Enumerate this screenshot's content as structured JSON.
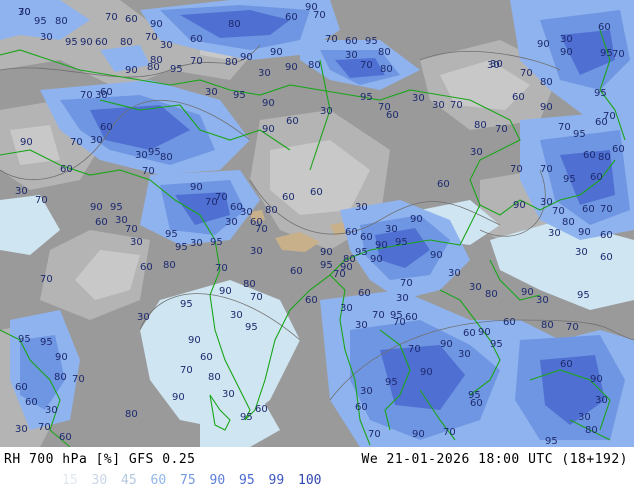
{
  "footer": {
    "title": "RH 700 hPa [%] GFS 0.25",
    "datetime": "We 21-01-2026 18:00 UTC (18+192)"
  },
  "legend": [
    {
      "label": "15",
      "color": "#dfe8f0"
    },
    {
      "label": "30",
      "color": "#c8d6e6"
    },
    {
      "label": "45",
      "color": "#b3c8e0"
    },
    {
      "label": "60",
      "color": "#8fb7ea"
    },
    {
      "label": "75",
      "color": "#7398e0"
    },
    {
      "label": "90",
      "color": "#5b7fd8"
    },
    {
      "label": "95",
      "color": "#4a6ad0"
    },
    {
      "label": "99",
      "color": "#3d58c0"
    },
    {
      "label": "100",
      "color": "#2f47ae"
    }
  ],
  "colors": {
    "dry_gray": "#9a9a9a",
    "mid_gray": "#b4b4b4",
    "light_gray": "#c8c8c8",
    "pale_blue": "#cfe6f2",
    "blue_60": "#8fb3ee",
    "blue_75": "#6f96e2",
    "blue_90": "#5a7fd9",
    "blue_95": "#4a6bd0",
    "coastline": "#1aa51a",
    "contour_text": "#1d2a6e",
    "terrain": "#c8b08a"
  },
  "contour_labels": [
    "30",
    "95",
    "80",
    "70",
    "60",
    "90",
    "60",
    "70",
    "80",
    "90",
    "30",
    "95",
    "90",
    "60",
    "80",
    "70",
    "30",
    "60",
    "80",
    "90",
    "30",
    "90",
    "80",
    "70",
    "60",
    "95",
    "80",
    "70",
    "80",
    "90",
    "30",
    "80",
    "90",
    "80",
    "95",
    "70",
    "30",
    "95",
    "90",
    "60",
    "90",
    "30",
    "95",
    "70",
    "60",
    "30",
    "30",
    "70",
    "80",
    "30",
    "70",
    "80",
    "90",
    "95",
    "70",
    "60",
    "30",
    "95",
    "90",
    "30",
    "60",
    "70",
    "60",
    "60",
    "30",
    "70",
    "70",
    "95",
    "60",
    "90",
    "30",
    "70",
    "80",
    "90",
    "60",
    "70",
    "60",
    "30",
    "70",
    "60",
    "90",
    "70",
    "95",
    "80",
    "60",
    "30",
    "95",
    "90",
    "90",
    "30",
    "30",
    "80",
    "90",
    "30",
    "95",
    "80",
    "70",
    "60",
    "95",
    "60",
    "90",
    "30",
    "30",
    "80",
    "95",
    "60",
    "70",
    "95",
    "90",
    "30",
    "60",
    "90",
    "70",
    "70",
    "30",
    "60",
    "30",
    "30",
    "70",
    "95",
    "60",
    "90",
    "95",
    "30",
    "60",
    "70",
    "90",
    "60",
    "70",
    "30",
    "60",
    "30",
    "70",
    "30",
    "95",
    "80",
    "70",
    "60",
    "90",
    "30",
    "70",
    "90",
    "95",
    "60",
    "30",
    "70",
    "30",
    "95",
    "95",
    "60",
    "80",
    "30",
    "95",
    "90",
    "70",
    "70",
    "60",
    "30",
    "60",
    "70",
    "80",
    "60",
    "30",
    "70",
    "80",
    "90",
    "30",
    "95",
    "60",
    "30",
    "60",
    "95",
    "60",
    "70",
    "95",
    "90",
    "80",
    "60",
    "90",
    "60",
    "95",
    "80",
    "70",
    "90",
    "95",
    "60",
    "30",
    "70",
    "30",
    "60",
    "80",
    "70",
    "90",
    "95",
    "60",
    "30",
    "80",
    "60",
    "90",
    "70",
    "30",
    "95",
    "70",
    "30",
    "60",
    "90",
    "70",
    "90",
    "30",
    "60",
    "70"
  ],
  "map_icon": "weather-map"
}
